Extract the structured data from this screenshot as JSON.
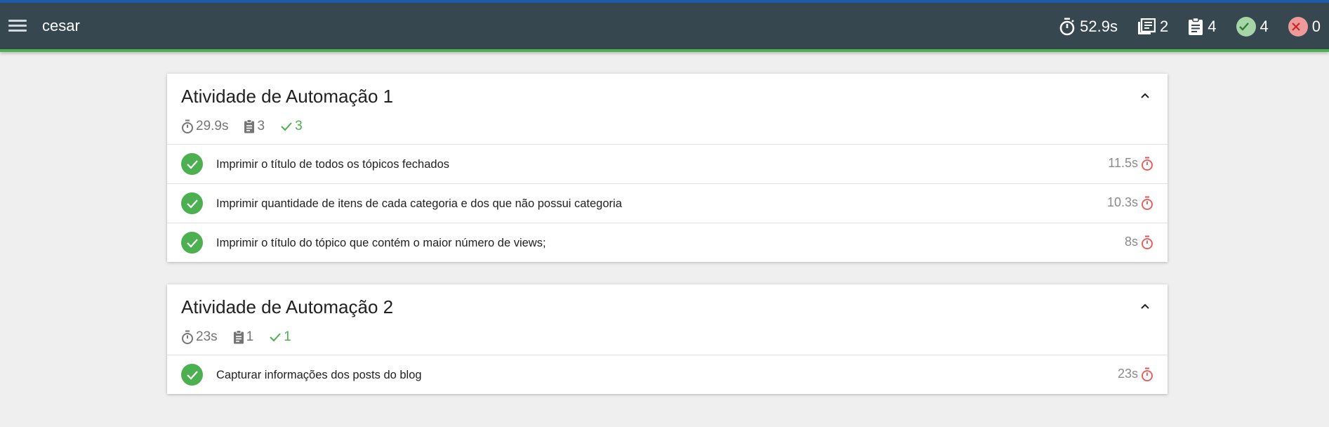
{
  "app": {
    "title": "cesar"
  },
  "header_stats": {
    "duration": "52.9s",
    "suites": "2",
    "tests": "4",
    "passed": "4",
    "failed": "0"
  },
  "colors": {
    "appbar": "#37474f",
    "accent_top": "#1e5aa8",
    "accent_bottom": "#4caf50",
    "pass": "#4caf50",
    "timer": "#ef5350"
  },
  "suites": [
    {
      "title": "Atividade de Automação 1",
      "duration": "29.9s",
      "tests": "3",
      "passed": "3",
      "rows": [
        {
          "text": "Imprimir o título de todos os tópicos fechados",
          "time": "11.5s"
        },
        {
          "text": "Imprimir quantidade de itens de cada categoria e dos que não possui categoria",
          "time": "10.3s"
        },
        {
          "text": "Imprimir o título do tópico que contém o maior número de views;",
          "time": "8s"
        }
      ]
    },
    {
      "title": "Atividade de Automação 2",
      "duration": "23s",
      "tests": "1",
      "passed": "1",
      "rows": [
        {
          "text": "Capturar informações dos posts do blog",
          "time": "23s"
        }
      ]
    }
  ]
}
